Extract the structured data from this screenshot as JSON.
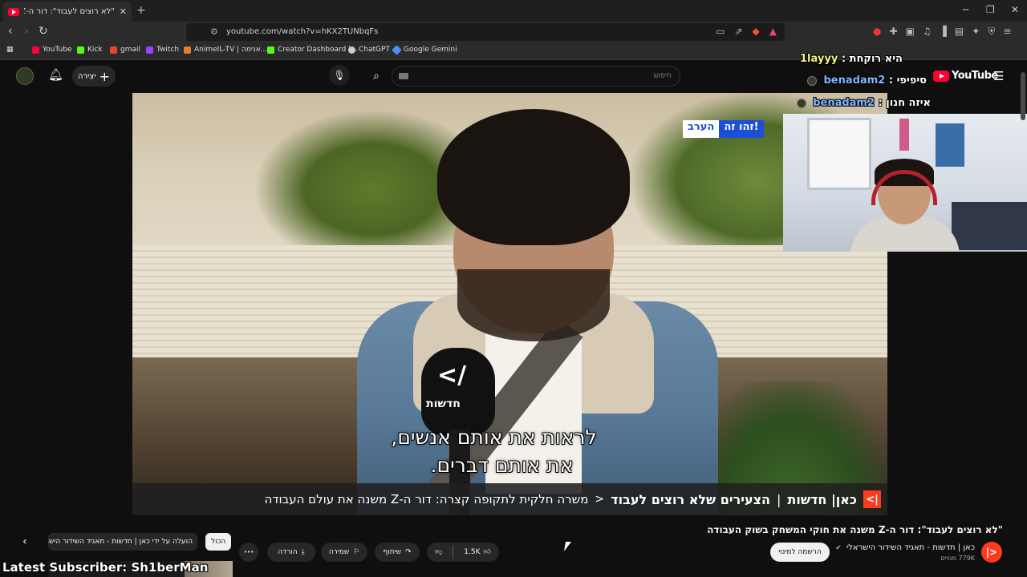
{
  "browser": {
    "tab_title": "\"לא רוצים לעבוד\": דור ה-Z משנה",
    "tab_close": "✕",
    "new_tab": "+",
    "url": "youtube.com/watch?v=hKX2TUNbqFs",
    "bookmarks": [
      {
        "label": "YouTube",
        "color": "#ff0033"
      },
      {
        "label": "Kick",
        "color": "#53fc18"
      },
      {
        "label": "gmail",
        "color": "#ea4335"
      },
      {
        "label": "Twitch",
        "color": "#9146ff"
      },
      {
        "label": "AnimeIL-TV | אנימה...",
        "color": "#e07b39"
      },
      {
        "label": "Creator Dashboard |...",
        "color": "#53fc18"
      },
      {
        "label": "ChatGPT",
        "color": "#cccccc"
      },
      {
        "label": "Google Gemini",
        "color": "#4f8df5"
      }
    ]
  },
  "youtube": {
    "create_label": "יצירה",
    "search_placeholder": "חיפוש",
    "logo_text": "YouTube"
  },
  "video": {
    "badge_zeh": "זהו זה!",
    "badge_erev": "הערב",
    "mic_logo": "</",
    "mic_text": "חדשות",
    "subtitle_line1": "לראות את אותם אנשים,",
    "subtitle_line2": "את אותם דברים.",
    "ticker_kan_mark": "|>",
    "ticker_brand": "כאן| חדשות",
    "ticker_sep": "|",
    "ticker_topic": "הצעירים שלא רוצים לעבוד",
    "ticker_arrow": "<",
    "ticker_headline": "משרה חלקית לתקופה קצרה: דור ה-Z משנה את עולם העבודה"
  },
  "overlay": {
    "chat": [
      {
        "user": "1layyy",
        "user_color": "yellow",
        "text": "היא רוקחת :"
      },
      {
        "user": "benadam2",
        "user_color": "blue",
        "text": "סיפיפי :"
      },
      {
        "user": "benadam2",
        "user_color": "blue",
        "text": "איזה חנון :"
      }
    ],
    "latest_subscriber": "Latest Subscriber: Sh1berMan"
  },
  "info": {
    "title": "\"לא רוצים לעבוד\": דור ה-Z משנה את חוקי המשחק בשוק העבודה",
    "channel_avatar": "|>",
    "channel_name": "כאן | חדשות - תאגיד השידור הישראלי",
    "verified": "✔",
    "subscribers": "779K מנויים",
    "subscribe_label": "הרשמה למינוי",
    "like_count": "1.5K",
    "share_label": "שיתוף",
    "save_label": "שמירה",
    "download_label": "הורדה",
    "more_label": "•••",
    "chip_all": "הכול",
    "chip_uploaded": "הועלה על ידי כאן | חדשות - תאגיד השידור הישראלי"
  }
}
